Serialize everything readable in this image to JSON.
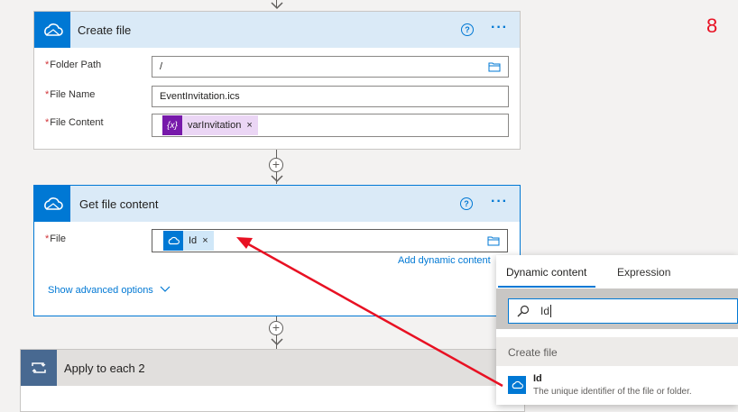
{
  "step_number": "8",
  "create_file": {
    "title": "Create file",
    "help": "?",
    "more": "···",
    "fields": [
      {
        "label": "Folder Path",
        "value": "/"
      },
      {
        "label": "File Name",
        "value": "EventInvitation.ics"
      },
      {
        "label": "File Content",
        "token_label": "varInvitation",
        "token_icon": "{x}"
      }
    ]
  },
  "get_file_content": {
    "title": "Get file content",
    "help": "?",
    "more": "···",
    "file_label": "File",
    "file_token": "Id",
    "add_dynamic_content": "Add dynamic content",
    "show_advanced": "Show advanced options"
  },
  "apply_to_each": {
    "title": "Apply to each 2"
  },
  "dynamic_panel": {
    "tabs": [
      "Dynamic content",
      "Expression"
    ],
    "active_tab": 0,
    "search_value": "Id",
    "section": "Create file",
    "item_title": "Id",
    "item_desc": "The unique identifier of the file or folder."
  },
  "colors": {
    "accent": "#0078d4",
    "variable": "#7719aa",
    "arrow": "#e81123",
    "step_number": "#e81123"
  }
}
